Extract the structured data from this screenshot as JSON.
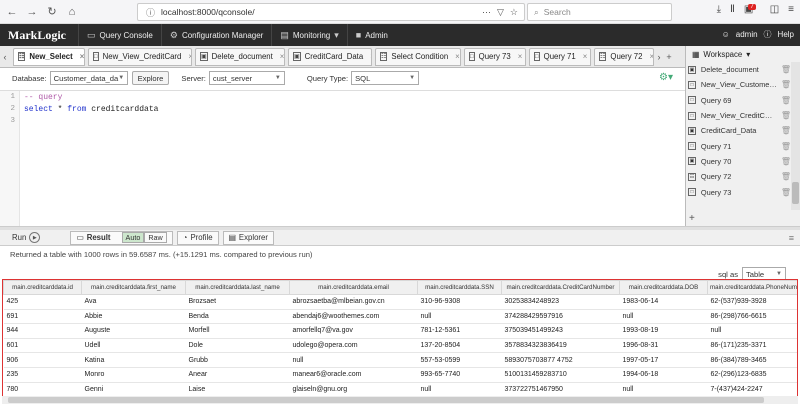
{
  "browser": {
    "url": "localhost:8000/qconsole/",
    "search_placeholder": "Search",
    "notification_count": "7"
  },
  "ml_bar": {
    "logo": "MarkLogic",
    "tabs": [
      "Query Console",
      "Configuration Manager",
      "Monitoring",
      "Admin"
    ],
    "user": "admin",
    "help": "Help"
  },
  "query_tabs": [
    "New_Select",
    "New_View_CreditCard",
    "Delete_document",
    "CreditCard_Data",
    "Select Condition",
    "Query 73",
    "Query 71",
    "Query 72"
  ],
  "controls": {
    "database_label": "Database:",
    "database_value": "Customer_data_da",
    "explore_label": "Explore",
    "server_label": "Server:",
    "server_value": "cust_server",
    "query_type_label": "Query Type:",
    "query_type_value": "SQL"
  },
  "editor": {
    "lines": [
      "-- query",
      "select * from creditcarddata",
      ""
    ]
  },
  "workspace": {
    "title": "Workspace",
    "items": [
      "Delete_document",
      "New_View_Custome…",
      "Query 69",
      "New_View_CreditC…",
      "CreditCard_Data",
      "Query 71",
      "Query 70",
      "Query 72",
      "Query 73"
    ]
  },
  "run_bar": {
    "run_label": "Run",
    "result_label": "Result",
    "auto_label": "Auto",
    "raw_label": "Raw",
    "profile_label": "Profile",
    "explorer_label": "Explorer"
  },
  "result_info": "Returned a table with 1000 rows in 59.6587 ms. (+15.1291 ms. compared to previous run)",
  "sql_as": {
    "label": "sql as",
    "value": "Table"
  },
  "table": {
    "headers": [
      "main.creditcarddata.id",
      "main.creditcarddata.first_name",
      "main.creditcarddata.last_name",
      "main.creditcarddata.email",
      "main.creditcarddata.SSN",
      "main.creditcarddata.CreditCardNumber",
      "main.creditcarddata.DOB",
      "main.creditcarddata.PhoneNum"
    ],
    "rows": [
      [
        "425",
        "Ava",
        "Brozsaet",
        "abrozsaetba@mlbeian.gov.cn",
        "310-96-9308",
        "30253834248923",
        "1983-06-14",
        "62-(537)939-3928"
      ],
      [
        "691",
        "Abbie",
        "Benda",
        "abendaj6@woothemes.com",
        "null",
        "374288429597916",
        "null",
        "86-(298)766-6615"
      ],
      [
        "944",
        "Auguste",
        "Morfell",
        "amorfellq7@va.gov",
        "781-12-5361",
        "375039451499243",
        "1993-08-19",
        "null"
      ],
      [
        "601",
        "Udell",
        "Dole",
        "udolego@opera.com",
        "137-20-8504",
        "3578834323836419",
        "1996-08-31",
        "86-(171)235-3371"
      ],
      [
        "906",
        "Katina",
        "Grubb",
        "null",
        "557-53-0599",
        "5893075703877 4752",
        "1997-05-17",
        "86-(384)789-3465"
      ],
      [
        "235",
        "Monro",
        "Anear",
        "manear6@oracle.com",
        "993-65-7740",
        "5100131459283710",
        "1994-06-18",
        "62-(296)123-6835"
      ],
      [
        "780",
        "Genni",
        "Laise",
        "glaiseln@gnu.org",
        "null",
        "373722751467950",
        "null",
        "7-(437)424-2247"
      ]
    ]
  }
}
